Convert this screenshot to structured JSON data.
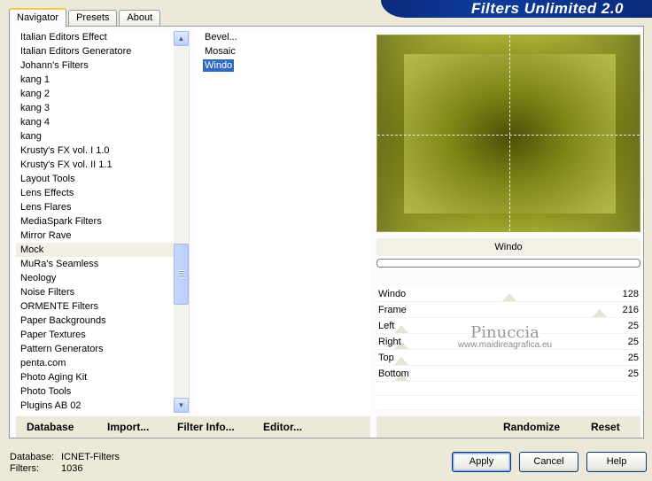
{
  "tabs": [
    {
      "label": "Navigator",
      "active": true
    },
    {
      "label": "Presets",
      "active": false
    },
    {
      "label": "About",
      "active": false
    }
  ],
  "app_title": "Filters Unlimited 2.0",
  "categories": [
    "Italian Editors Effect",
    "Italian Editors Generatore",
    "Johann's Filters",
    "kang 1",
    "kang 2",
    "kang 3",
    "kang 4",
    "kang",
    "Krusty's FX vol. I 1.0",
    "Krusty's FX vol. II 1.1",
    "Layout Tools",
    "Lens Effects",
    "Lens Flares",
    "MediaSpark Filters",
    "Mirror Rave",
    "Mock",
    "MuRa's Seamless",
    "Neology",
    "Noise Filters",
    "ORMENTE Filters",
    "Paper Backgrounds",
    "Paper Textures",
    "Pattern Generators",
    "penta.com",
    "Photo Aging Kit",
    "Photo Tools",
    "Plugins AB 02"
  ],
  "selected_category": "Mock",
  "filters": [
    "Bevel...",
    "Mosaic",
    "Windo"
  ],
  "selected_filter": "Windo",
  "control_title": "Windo",
  "params": [
    {
      "name": "Windo",
      "value": "128"
    },
    {
      "name": "Frame",
      "value": "216"
    },
    {
      "name": "Left",
      "value": "25"
    },
    {
      "name": "Right",
      "value": "25"
    },
    {
      "name": "Top",
      "value": "25"
    },
    {
      "name": "Bottom",
      "value": "25"
    }
  ],
  "watermark": {
    "line1": "Pinuccia",
    "line2": "www.maidireagrafica.eu"
  },
  "toolbar": {
    "database": "Database",
    "import": "Import...",
    "filter_info": "Filter Info...",
    "editor": "Editor...",
    "randomize": "Randomize",
    "reset": "Reset"
  },
  "status": {
    "database_label": "Database:",
    "database_value": "ICNET-Filters",
    "filters_label": "Filters:",
    "filters_value": "1036"
  },
  "buttons": {
    "apply": "Apply",
    "cancel": "Cancel",
    "help": "Help"
  },
  "colors": {
    "title_bar": "#0f3c9e",
    "selection": "#316ac5",
    "preview_frame": "#5a6200",
    "preview_window": "#a8ad3e"
  }
}
